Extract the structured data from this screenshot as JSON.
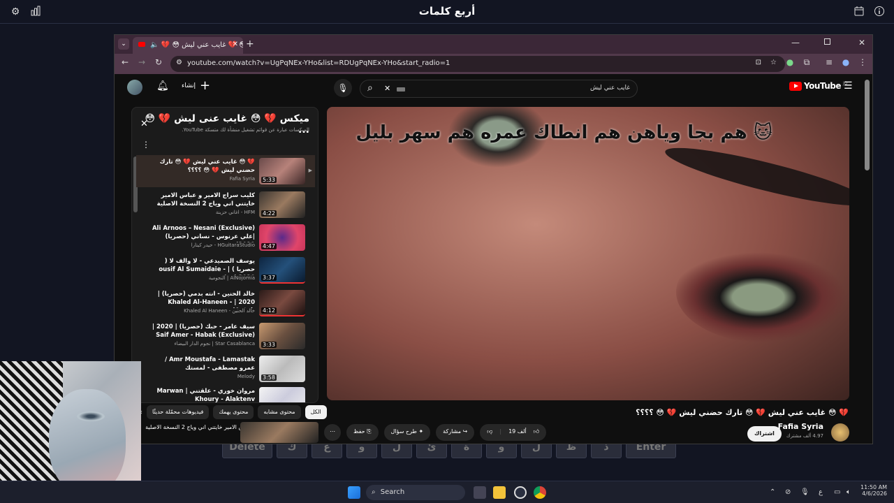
{
  "app": {
    "title": "أربع كلمات"
  },
  "keyboard": {
    "keys": [
      "Delete",
      "ك",
      "ع",
      "و",
      "ل",
      "ئ",
      "ة",
      "و",
      "ل",
      "ظ",
      "ذ",
      "Enter"
    ]
  },
  "browser": {
    "tab_title": "🔈 💔 😳 غايب عني ليش 💔 😳",
    "url": "youtube.com/watch?v=UgPqNEx-YHo&list=RDUgPqNEx-YHo&start_radio=1"
  },
  "youtube": {
    "logo": "YouTube",
    "logo_country": "JO",
    "search_value": "غايب عني ليش",
    "create_label": "إنشاء",
    "video": {
      "overlay_text": "هم بجا وياهن هم انطاك عمره هم سهر بليل 🐱",
      "title": "💔 😳 غايب عني ليش 💔 😳 تارك حضني ليش 💔 😳 ؟؟؟؟",
      "channel": "Fafia Syria",
      "subscribers": "4.97 ألف مشترك",
      "subscribe_label": "اشتراك",
      "likes": "19 ألف",
      "share_label": "مشاركة",
      "ask_label": "طرح سؤال",
      "save_label": "حفظ"
    },
    "playlist": {
      "title": "ميكس 💔 😳 غايب عنى ليش 💔 😳 ...",
      "subtitle": "الميكسات عبارة عن قوائم تشغيل منشأة لك متسكة YouTube.",
      "items": [
        {
          "title": "💔 😳 غايب عني ليش 💔 😳 تارك حضني ليش 💔 😳 ؟؟؟؟",
          "channel": "Fafia Syria",
          "duration": "5:33"
        },
        {
          "title": "كليب سراج الامير و عباس الامير خايتني اني وياج 2 النسخة الاصلية",
          "channel": "HFM - اغاني حزينة",
          "duration": "4:22"
        },
        {
          "title": "Ali Arnoos – Nesani (Exclusive) |علي عرنوس - نساني (حصريا) 2019|",
          "channel": "HGuitaraStudio - حيدر كيتارا",
          "duration": "4:47"
        },
        {
          "title": "يوسف الصميدعي - لا والف لا ( حصريا ) | ousif Al Sumaidaie - La | 2020...",
          "channel": "AlNojomia | النجومية",
          "duration": "3:37"
        },
        {
          "title": "خالد الحنين - انته بدمي (حصريا) | 2020 | Khaled Al-Haneen - Antah)...",
          "channel": "خالد الحنين - Khaled Al Haneen",
          "duration": "4:12"
        },
        {
          "title": "سيف عامر - حبك (حصريا) | 2020 | Saif Amer - Habak (Exclusive)",
          "channel": "Star Casablanca | نجوم الدار البيضاء",
          "duration": "3:33"
        },
        {
          "title": "Amr Moustafa - Lamastak / عمرو مصطفى - لمستك",
          "channel": "Melody",
          "duration": "3:58"
        },
        {
          "title": "مروان خوري - علقتني | Marwan Khoury - Alaktenv",
          "channel": "",
          "duration": ""
        }
      ]
    },
    "chips": [
      "الكل",
      "محتوى مشابه",
      "محتوى يهمك",
      "فيديوهات محمّلة حديثًا"
    ],
    "next_item_title": "كليب سراج الامير و عباس الامير خايتني اني وياج 2 النسخة الاصلية"
  },
  "taskbar": {
    "search_label": "Search",
    "lang": "ع",
    "time": "11:50 AM",
    "date": "4/6/2026"
  }
}
